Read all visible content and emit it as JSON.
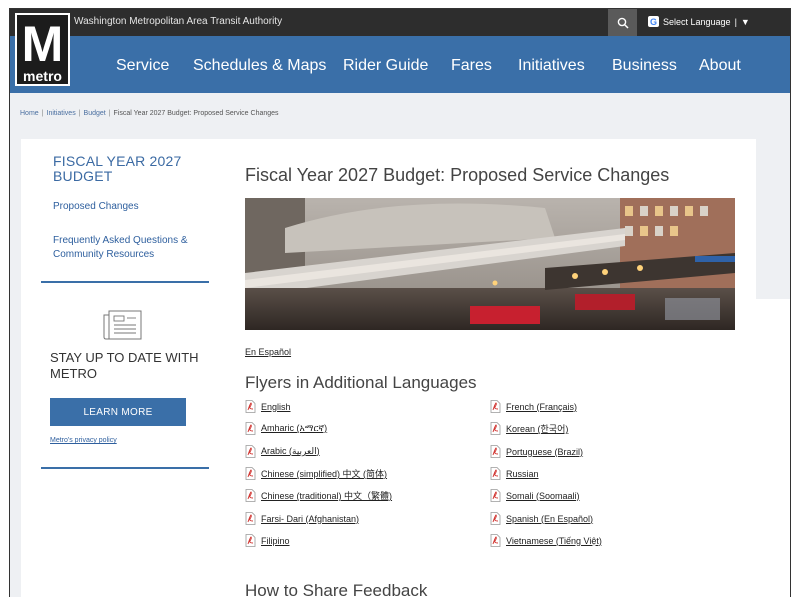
{
  "topbar": {
    "agency": "Washington Metropolitan Area Transit Authority",
    "language_label": "Select Language",
    "language_sep": "|"
  },
  "logo": {
    "letter": "M",
    "word": "metro"
  },
  "nav": {
    "items": [
      {
        "label": "Service"
      },
      {
        "label": "Schedules & Maps"
      },
      {
        "label": "Rider Guide"
      },
      {
        "label": "Fares"
      },
      {
        "label": "Initiatives"
      },
      {
        "label": "Business"
      },
      {
        "label": "About"
      }
    ]
  },
  "breadcrumb": {
    "items": [
      "Home",
      "Initiatives",
      "Budget"
    ],
    "current": "Fiscal Year 2027 Budget: Proposed Service Changes"
  },
  "sidebar": {
    "title": "FISCAL YEAR 2027 BUDGET",
    "links": [
      {
        "label": "Proposed Changes"
      },
      {
        "label": "Frequently Asked Questions & Community Resources"
      }
    ],
    "stay_title": "STAY UP TO DATE WITH METRO",
    "learn_more": "LEARN MORE",
    "privacy": "Metro's privacy policy"
  },
  "main": {
    "title": "Fiscal Year 2027 Budget: Proposed Service Changes",
    "espanol": "En Español",
    "flyers_title": "Flyers in Additional Languages",
    "flyers_left": [
      "English",
      "Amharic (አማርኛ)",
      "Arabic (العربية)",
      "Chinese (simplified) 中文 (简体)",
      "Chinese (traditional) 中文（繁體)",
      "Farsi- Dari (Afghanistan)",
      "Filipino"
    ],
    "flyers_right": [
      "French (Français)",
      "Korean (한국어)",
      "Portuguese (Brazil)",
      "Russian",
      "Somali (Soomaali)",
      "Spanish (En Español)",
      "Vietnamese (Tiếng Việt)"
    ],
    "share_title": "How to Share Feedback"
  },
  "colors": {
    "nav_blue": "#3a6fa8",
    "topbar": "#2d2d2d",
    "link_blue": "#2e5f9e"
  }
}
